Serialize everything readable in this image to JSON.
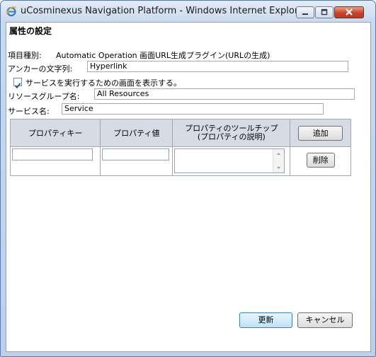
{
  "window": {
    "title": "uCosminexus Navigation Platform - Windows Internet Explorer"
  },
  "dialog": {
    "heading": "属性の設定",
    "item_type_label": "項目種別:",
    "item_type_value": "Automatic Operation 画面URL生成プラグイン(URLの生成)",
    "anchor_label": "アンカーの文字列:",
    "anchor_value": "Hyperlink",
    "show_screen_checkbox_label": "サービスを実行するための画面を表示する。",
    "show_screen_checked": true,
    "resource_group_label": "リソースグループ名:",
    "resource_group_value": "All Resources",
    "service_name_label": "サービス名:",
    "service_name_value": "Service"
  },
  "properties_table": {
    "headers": [
      "プロパティキー",
      "プロパティ値",
      "プロパティのツールチップ",
      "(プロパティの説明)"
    ],
    "add_button": "追加",
    "delete_button": "削除",
    "rows": [
      {
        "key": "",
        "value": "",
        "tooltip": ""
      }
    ]
  },
  "footer": {
    "update_button": "更新",
    "cancel_button": "キャンセル"
  },
  "icons": [
    "ie-icon",
    "minimize-icon",
    "maximize-icon",
    "close-icon",
    "scroll-up-icon",
    "scroll-down-icon"
  ]
}
